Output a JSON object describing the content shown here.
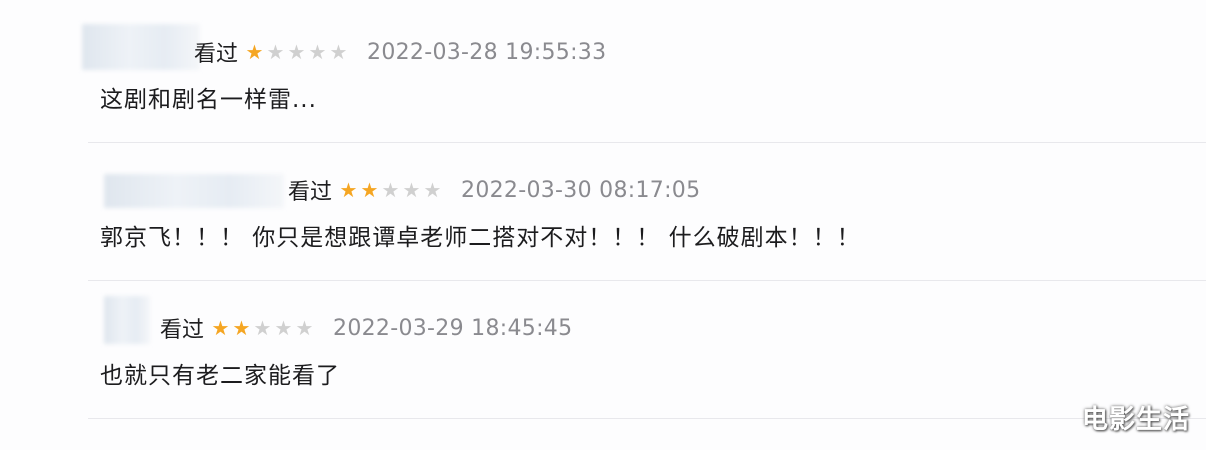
{
  "reviews": [
    {
      "status": "看过",
      "rating": 1,
      "max_rating": 5,
      "time": "2022-03-28 19:55:33",
      "text": "这剧和剧名一样雷..."
    },
    {
      "status": "看过",
      "rating": 2,
      "max_rating": 5,
      "time": "2022-03-30 08:17:05",
      "text": "郭京飞！！！ 你只是想跟谭卓老师二搭对不对！！！ 什么破剧本！！！"
    },
    {
      "status": "看过",
      "rating": 2,
      "max_rating": 5,
      "time": "2022-03-29 18:45:45",
      "text": "也就只有老二家能看了"
    }
  ],
  "watermark": "电影生活",
  "colors": {
    "star_on": "#f5a623",
    "star_off": "#d0d0d0",
    "time": "#8a8a8f"
  }
}
